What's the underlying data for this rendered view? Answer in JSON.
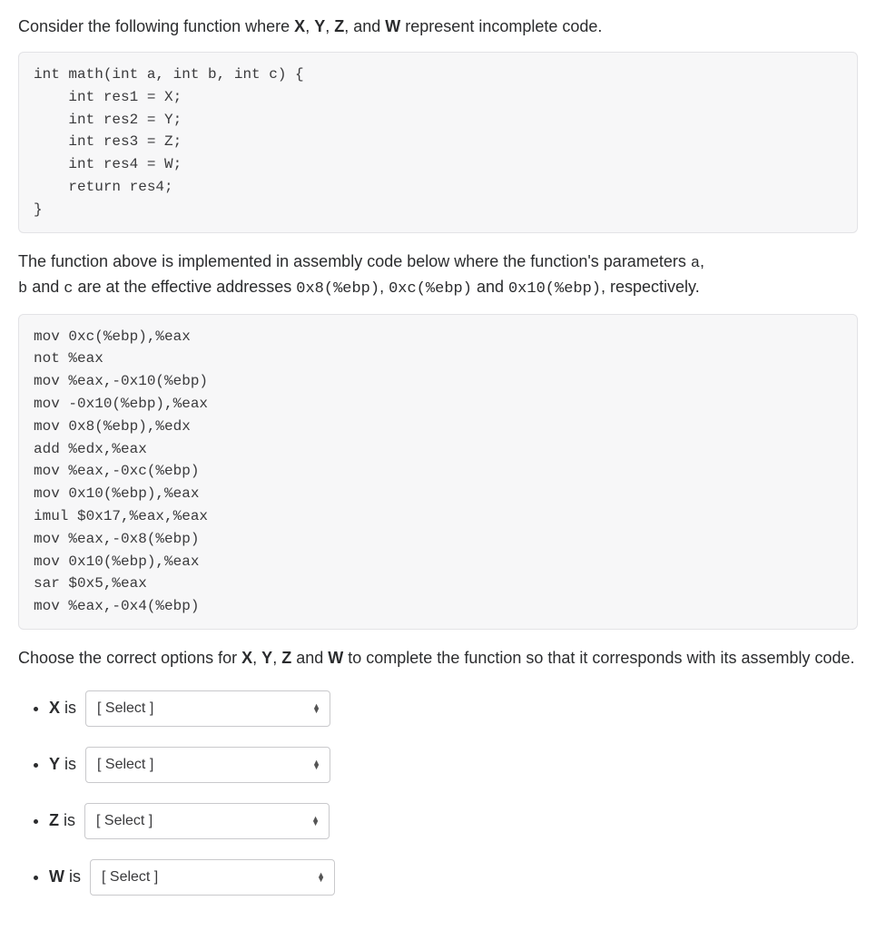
{
  "intro": {
    "prefix": "Consider the following function where ",
    "vars": [
      "X",
      "Y",
      "Z",
      "W"
    ],
    "sep1": ", ",
    "sep2": ", ",
    "sep3": ", and ",
    "suffix": " represent incomplete code."
  },
  "code1": "int math(int a, int b, int c) {\n    int res1 = X;\n    int res2 = Y;\n    int res3 = Z;\n    int res4 = W;\n    return res4;\n}",
  "middle": {
    "l1a": "The function above is implemented in assembly code below where the function's parameters ",
    "l1b": "a",
    "l1c": ",",
    "l2a": "b",
    "l2b": " and ",
    "l2c": "c",
    "l2d": " are at the effective addresses ",
    "addr1": "0x8(%ebp)",
    "comma1": ", ",
    "addr2": "0xc(%ebp)",
    "and": " and ",
    "addr3": "0x10(%ebp)",
    "tail": ", respectively."
  },
  "code2": "mov 0xc(%ebp),%eax\nnot %eax\nmov %eax,-0x10(%ebp)\nmov -0x10(%ebp),%eax\nmov 0x8(%ebp),%edx\nadd %edx,%eax\nmov %eax,-0xc(%ebp)\nmov 0x10(%ebp),%eax\nimul $0x17,%eax,%eax\nmov %eax,-0x8(%ebp)\nmov 0x10(%ebp),%eax\nsar $0x5,%eax\nmov %eax,-0x4(%ebp)",
  "choose": {
    "a": "Choose the correct options for ",
    "b": " and ",
    "c": " to complete the function so that it corresponds with its assembly code.",
    "vars": [
      "X",
      "Y",
      "Z",
      "W"
    ],
    "sep": ", "
  },
  "answers": [
    {
      "var": "X",
      "is": " is",
      "placeholder": "[ Select ]"
    },
    {
      "var": "Y",
      "is": " is",
      "placeholder": "[ Select ]"
    },
    {
      "var": "Z",
      "is": " is",
      "placeholder": "[ Select ]"
    },
    {
      "var": "W",
      "is": " is",
      "placeholder": "[ Select ]"
    }
  ]
}
